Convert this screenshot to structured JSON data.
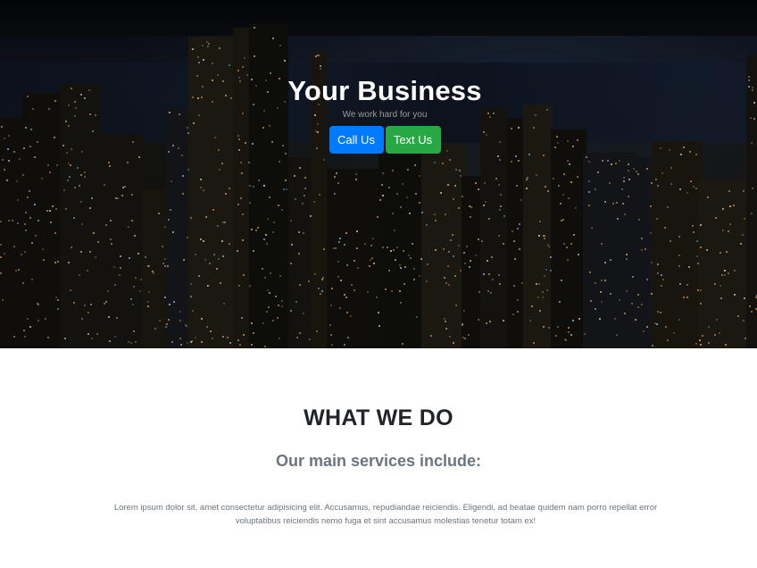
{
  "hero": {
    "title": "Your Business",
    "subtitle": "We work hard for you",
    "buttons": {
      "call_label": "Call Us",
      "text_label": "Text Us"
    }
  },
  "services": {
    "title": "WHAT WE DO",
    "subtitle": "Our main services include:",
    "body": "Lorem ipsum dolor sit, amet consectetur adipisicing elit. Accusamus, repudiandae reiciendis. Eligendi, ad beatae quidem nam porro repellat error voluptatibus reiciendis nemo fuga et sint accusamus molestias tenetur totam ex!"
  },
  "colors": {
    "primary_button": "#007bff",
    "success_button": "#28a745",
    "heading_text": "#212529",
    "muted_text": "#6c757d"
  }
}
